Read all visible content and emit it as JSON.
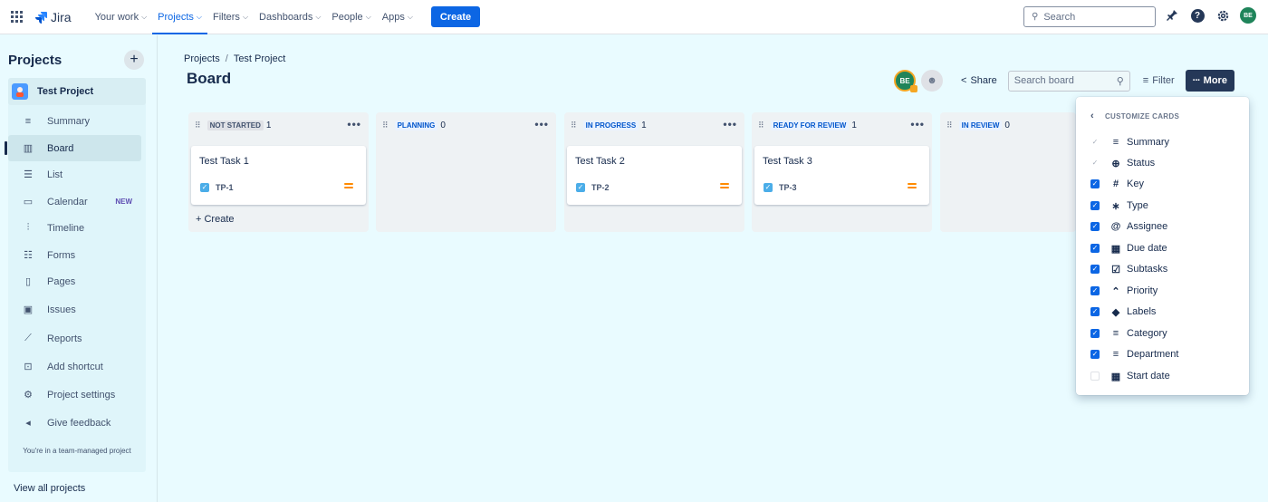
{
  "topnav": {
    "logo_text": "Jira",
    "items": [
      {
        "label": "Your work",
        "active": false
      },
      {
        "label": "Projects",
        "active": true
      },
      {
        "label": "Filters",
        "active": false
      },
      {
        "label": "Dashboards",
        "active": false
      },
      {
        "label": "People",
        "active": false
      },
      {
        "label": "Apps",
        "active": false
      }
    ],
    "create_label": "Create",
    "search_placeholder": "Search",
    "avatar_initials": "BE"
  },
  "sidebar": {
    "title": "Projects",
    "project_name": "Test Project",
    "items": [
      {
        "label": "Summary",
        "icon": "summary-icon"
      },
      {
        "label": "Board",
        "icon": "board-icon"
      },
      {
        "label": "List",
        "icon": "list-icon"
      },
      {
        "label": "Calendar",
        "icon": "calendar-icon",
        "badge": "NEW"
      },
      {
        "label": "Timeline",
        "icon": "timeline-icon"
      },
      {
        "label": "Forms",
        "icon": "forms-icon"
      },
      {
        "label": "Pages",
        "icon": "pages-icon"
      },
      {
        "label": "Issues",
        "icon": "issues-icon"
      },
      {
        "label": "Reports",
        "icon": "reports-icon"
      },
      {
        "label": "Add shortcut",
        "icon": "add-shortcut-icon"
      },
      {
        "label": "Project settings",
        "icon": "settings-icon"
      },
      {
        "label": "Give feedback",
        "icon": "megaphone-icon"
      }
    ],
    "note": "You're in a team-managed project",
    "view_all": "View all projects"
  },
  "main": {
    "breadcrumb": {
      "root": "Projects",
      "sep": "/",
      "current": "Test Project"
    },
    "title": "Board",
    "toolbar": {
      "avatar_initials": "BE",
      "share_label": "Share",
      "search_placeholder": "Search board",
      "filter_label": "Filter",
      "more_label": "More"
    },
    "columns": [
      {
        "name": "NOT STARTED",
        "count": "1",
        "color": "#dfe1e6",
        "text_color": "#42526e",
        "cards": [
          {
            "title": "Test Task 1",
            "key": "TP-1"
          }
        ],
        "create_label": "Create"
      },
      {
        "name": "PLANNING",
        "count": "0",
        "color": "#e9f2ff",
        "text_color": "#0055cc",
        "cards": []
      },
      {
        "name": "IN PROGRESS",
        "count": "1",
        "color": "#e9f2ff",
        "text_color": "#0055cc",
        "cards": [
          {
            "title": "Test Task 2",
            "key": "TP-2"
          }
        ]
      },
      {
        "name": "READY FOR REVIEW",
        "count": "1",
        "color": "#e9f2ff",
        "text_color": "#0055cc",
        "cards": [
          {
            "title": "Test Task 3",
            "key": "TP-3"
          }
        ]
      },
      {
        "name": "IN REVIEW",
        "count": "0",
        "color": "#e9f2ff",
        "text_color": "#0055cc",
        "cards": []
      }
    ]
  },
  "customize": {
    "title": "CUSTOMIZE CARDS",
    "options": [
      {
        "label": "Summary",
        "state": "disabled",
        "icon": "summary-icon"
      },
      {
        "label": "Status",
        "state": "disabled",
        "icon": "status-icon"
      },
      {
        "label": "Key",
        "state": "checked",
        "icon": "hash-icon"
      },
      {
        "label": "Type",
        "state": "checked",
        "icon": "asterisk-icon"
      },
      {
        "label": "Assignee",
        "state": "checked",
        "icon": "at-icon"
      },
      {
        "label": "Due date",
        "state": "checked",
        "icon": "calendar-icon"
      },
      {
        "label": "Subtasks",
        "state": "checked",
        "icon": "subtasks-icon"
      },
      {
        "label": "Priority",
        "state": "checked",
        "icon": "priority-icon"
      },
      {
        "label": "Labels",
        "state": "checked",
        "icon": "tag-icon"
      },
      {
        "label": "Category",
        "state": "checked",
        "icon": "category-icon"
      },
      {
        "label": "Department",
        "state": "checked",
        "icon": "department-icon"
      },
      {
        "label": "Start date",
        "state": "unchecked",
        "icon": "calendar-icon"
      }
    ]
  },
  "colors": {
    "primary": "#0c66e4",
    "background": "#e9fbff",
    "more_button": "#253858"
  }
}
